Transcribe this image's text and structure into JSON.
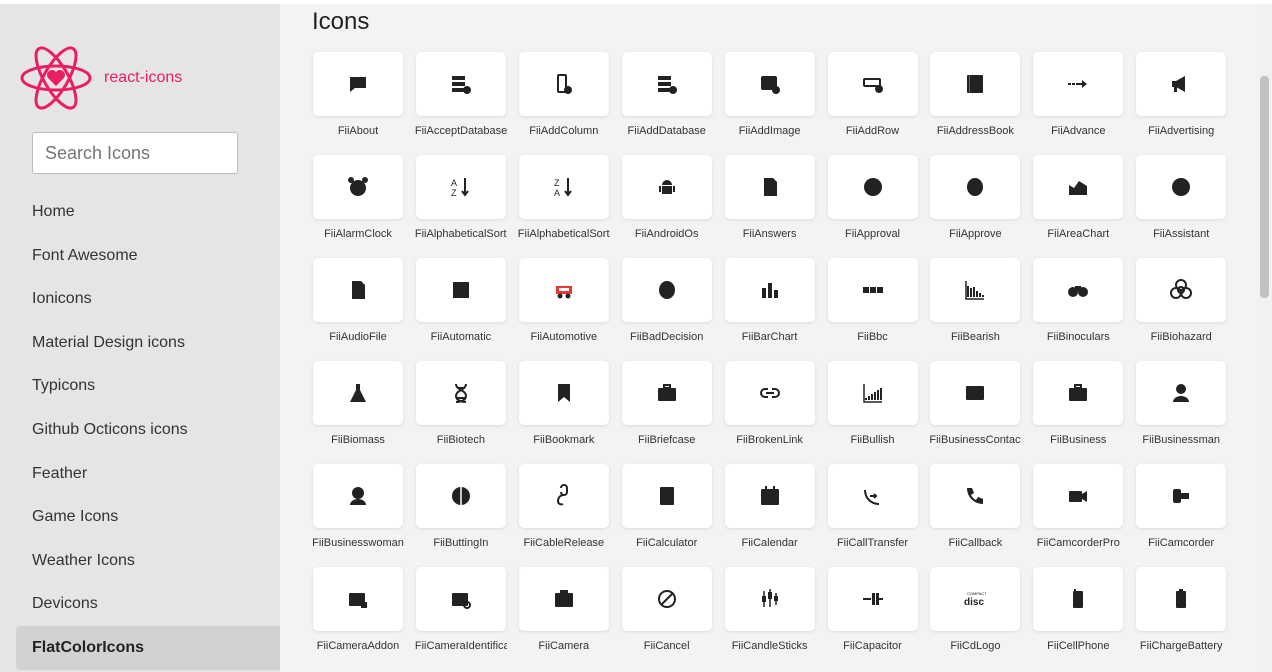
{
  "brand": {
    "name": "react-icons",
    "color": "#e91e63"
  },
  "search": {
    "placeholder": "Search Icons",
    "value": ""
  },
  "nav": [
    {
      "label": "Home",
      "active": false
    },
    {
      "label": "Font Awesome",
      "active": false
    },
    {
      "label": "Ionicons",
      "active": false
    },
    {
      "label": "Material Design icons",
      "active": false
    },
    {
      "label": "Typicons",
      "active": false
    },
    {
      "label": "Github Octicons icons",
      "active": false
    },
    {
      "label": "Feather",
      "active": false
    },
    {
      "label": "Game Icons",
      "active": false
    },
    {
      "label": "Weather Icons",
      "active": false
    },
    {
      "label": "Devicons",
      "active": false
    },
    {
      "label": "FlatColorIcons",
      "active": true
    }
  ],
  "page": {
    "title": "Icons"
  },
  "icons": [
    {
      "label": "FiiAbout",
      "icon": "chat-bubble-icon"
    },
    {
      "label": "FiiAcceptDatabase",
      "icon": "database-add-icon"
    },
    {
      "label": "FiiAddColumn",
      "icon": "add-column-icon"
    },
    {
      "label": "FiiAddDatabase",
      "icon": "database-add-icon"
    },
    {
      "label": "FiiAddImage",
      "icon": "add-image-icon"
    },
    {
      "label": "FiiAddRow",
      "icon": "add-row-icon"
    },
    {
      "label": "FiiAddressBook",
      "icon": "address-book-icon"
    },
    {
      "label": "FiiAdvance",
      "icon": "advance-arrow-icon"
    },
    {
      "label": "FiiAdvertising",
      "icon": "megaphone-icon"
    },
    {
      "label": "FiiAlarmClock",
      "icon": "alarm-clock-icon"
    },
    {
      "label": "FiiAlphabeticalSorting",
      "icon": "sort-az-icon"
    },
    {
      "label": "FiiAlphabeticalSorting",
      "icon": "sort-za-icon"
    },
    {
      "label": "FiiAndroidOs",
      "icon": "android-icon"
    },
    {
      "label": "FiiAnswers",
      "icon": "document-icon"
    },
    {
      "label": "FiiApproval",
      "icon": "approval-seal-icon"
    },
    {
      "label": "FiiApprove",
      "icon": "approve-head-icon"
    },
    {
      "label": "FiiAreaChart",
      "icon": "area-chart-icon"
    },
    {
      "label": "FiiAssistant",
      "icon": "assistant-icon"
    },
    {
      "label": "FiiAudioFile",
      "icon": "audio-file-icon"
    },
    {
      "label": "FiiAutomatic",
      "icon": "automatic-icon"
    },
    {
      "label": "FiiAutomotive",
      "icon": "car-icon"
    },
    {
      "label": "FiiBadDecision",
      "icon": "bad-decision-icon"
    },
    {
      "label": "FiiBarChart",
      "icon": "bar-chart-icon"
    },
    {
      "label": "FiiBbc",
      "icon": "bbc-icon"
    },
    {
      "label": "FiiBearish",
      "icon": "bearish-chart-icon"
    },
    {
      "label": "FiiBinoculars",
      "icon": "binoculars-icon"
    },
    {
      "label": "FiiBiohazard",
      "icon": "biohazard-icon"
    },
    {
      "label": "FiiBiomass",
      "icon": "flask-icon"
    },
    {
      "label": "FiiBiotech",
      "icon": "dna-icon"
    },
    {
      "label": "FiiBookmark",
      "icon": "bookmark-icon"
    },
    {
      "label": "FiiBriefcase",
      "icon": "briefcase-icon"
    },
    {
      "label": "FiiBrokenLink",
      "icon": "broken-link-icon"
    },
    {
      "label": "FiiBullish",
      "icon": "bullish-chart-icon"
    },
    {
      "label": "FiiBusinessContact",
      "icon": "business-contact-icon"
    },
    {
      "label": "FiiBusiness",
      "icon": "business-briefcase-icon"
    },
    {
      "label": "FiiBusinessman",
      "icon": "businessman-icon"
    },
    {
      "label": "FiiBusinesswoman",
      "icon": "businesswoman-icon"
    },
    {
      "label": "FiiButtingIn",
      "icon": "butting-in-icon"
    },
    {
      "label": "FiiCableRelease",
      "icon": "cable-release-icon"
    },
    {
      "label": "FiiCalculator",
      "icon": "calculator-icon"
    },
    {
      "label": "FiiCalendar",
      "icon": "calendar-icon"
    },
    {
      "label": "FiiCallTransfer",
      "icon": "call-transfer-icon"
    },
    {
      "label": "FiiCallback",
      "icon": "callback-icon"
    },
    {
      "label": "FiiCamcorderPro",
      "icon": "camcorder-pro-icon"
    },
    {
      "label": "FiiCamcorder",
      "icon": "camcorder-icon"
    },
    {
      "label": "FiiCameraAddon",
      "icon": "camera-addon-icon"
    },
    {
      "label": "FiiCameraIdentification",
      "icon": "camera-identification-icon"
    },
    {
      "label": "FiiCamera",
      "icon": "camera-icon"
    },
    {
      "label": "FiiCancel",
      "icon": "cancel-icon"
    },
    {
      "label": "FiiCandleSticks",
      "icon": "candlesticks-icon"
    },
    {
      "label": "FiiCapacitor",
      "icon": "capacitor-icon"
    },
    {
      "label": "FiiCdLogo",
      "icon": "cd-logo-icon"
    },
    {
      "label": "FiiCellPhone",
      "icon": "cell-phone-icon"
    },
    {
      "label": "FiiChargeBattery",
      "icon": "charge-battery-icon"
    }
  ]
}
